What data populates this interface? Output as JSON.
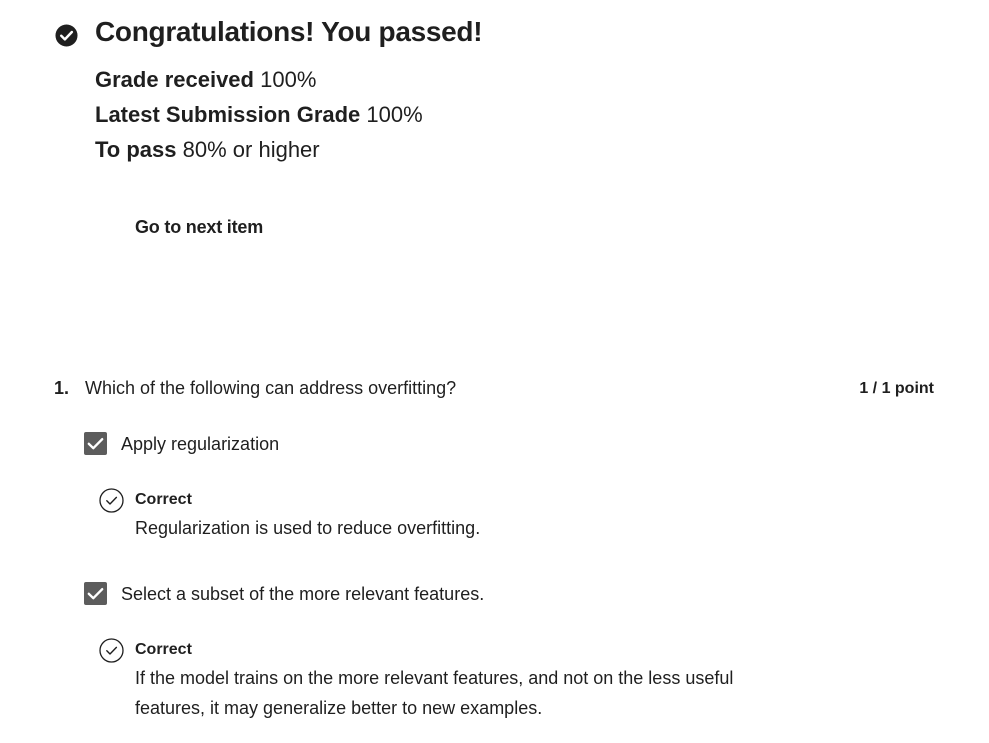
{
  "result": {
    "title": "Congratulations! You passed!",
    "grade_received_label": "Grade received",
    "grade_received_value": "100%",
    "latest_label": "Latest Submission Grade",
    "latest_value": "100%",
    "to_pass_label": "To pass",
    "to_pass_value": "80% or higher",
    "next_label": "Go to next item"
  },
  "question": {
    "number": "1.",
    "text": "Which of the following can address overfitting?",
    "points": "1 / 1 point",
    "options": [
      {
        "label": "Apply regularization",
        "checked": true,
        "feedback_title": "Correct",
        "feedback_text": "Regularization is used to reduce overfitting."
      },
      {
        "label": "Select a subset of the more relevant features.",
        "checked": true,
        "feedback_title": "Correct",
        "feedback_text": "If the model trains on the more relevant features, and not on the less useful features, it may generalize better to new examples."
      }
    ]
  },
  "icons": {
    "pass": "check-circle-filled-icon",
    "checkbox": "checkmark-icon",
    "feedback": "check-circle-outline-icon"
  },
  "colors": {
    "text": "#1f1f1f",
    "checkbox": "#5c5c5c"
  }
}
